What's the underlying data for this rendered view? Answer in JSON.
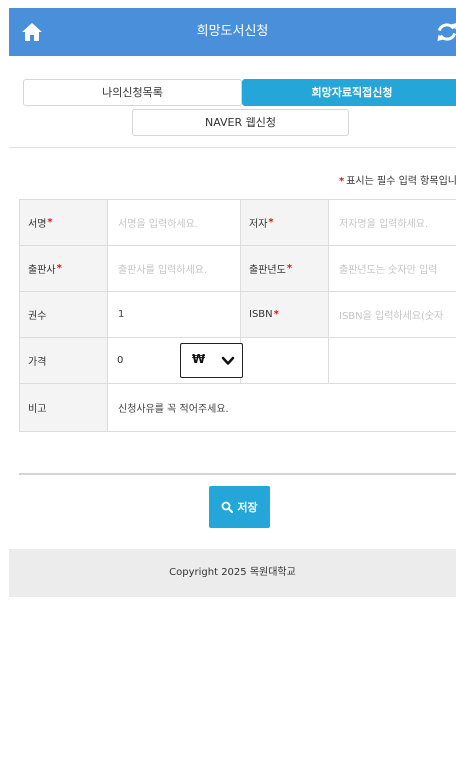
{
  "header": {
    "title": "희망도서신청",
    "home_icon": "home-icon",
    "refresh_icon": "refresh-icon"
  },
  "tabs": {
    "my_list": "나의신청목록",
    "direct_request": "희망자료직접신청",
    "naver": "NAVER 웹신청"
  },
  "required_note": {
    "star": "*",
    "text": "표시는 필수 입력 항목입니다"
  },
  "form": {
    "title_label": "서명",
    "title_placeholder": "서명을 입력하세요.",
    "author_label": "저자",
    "author_placeholder": "저자명을 입력하세요.",
    "publisher_label": "출판사",
    "publisher_placeholder": "출판사를 입력하세요.",
    "pubyear_label": "출판년도",
    "pubyear_placeholder": "출판년도는 숫자만 입력",
    "copies_label": "권수",
    "copies_value": "1",
    "isbn_label": "ISBN",
    "isbn_placeholder": "ISBN을 입력하세요(숫자",
    "price_label": "가격",
    "price_value": "0",
    "currency_value": "₩",
    "note_label": "비고",
    "note_placeholder": "신청사유를 꼭 적어주세요.",
    "required_star": "*"
  },
  "actions": {
    "save_label": "저장"
  },
  "footer": {
    "copyright": "Copyright 2025 목원대학교"
  },
  "colors": {
    "header_bg": "#4a8fd9",
    "accent": "#24a7d8",
    "required": "#e0161b"
  }
}
